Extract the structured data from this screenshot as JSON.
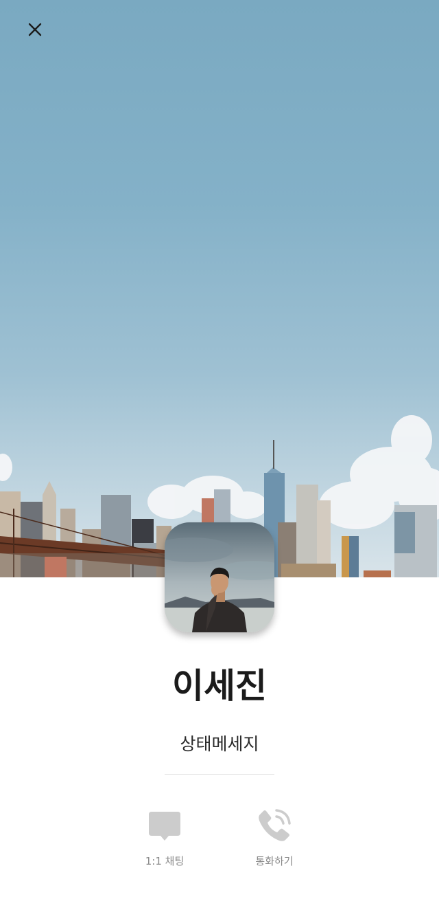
{
  "header": {
    "close_icon": "close-icon"
  },
  "profile": {
    "name": "이세진",
    "status_message": "상태메세지",
    "avatar_icon": "profile-photo"
  },
  "actions": [
    {
      "label": "1:1 채팅",
      "icon": "chat-bubble-icon"
    },
    {
      "label": "통화하기",
      "icon": "phone-call-icon"
    }
  ],
  "colors": {
    "sky": "#84b1c8",
    "icon_gray": "#cccccc",
    "label_gray": "#8a8a8a",
    "name_text": "#1b1b1b"
  }
}
